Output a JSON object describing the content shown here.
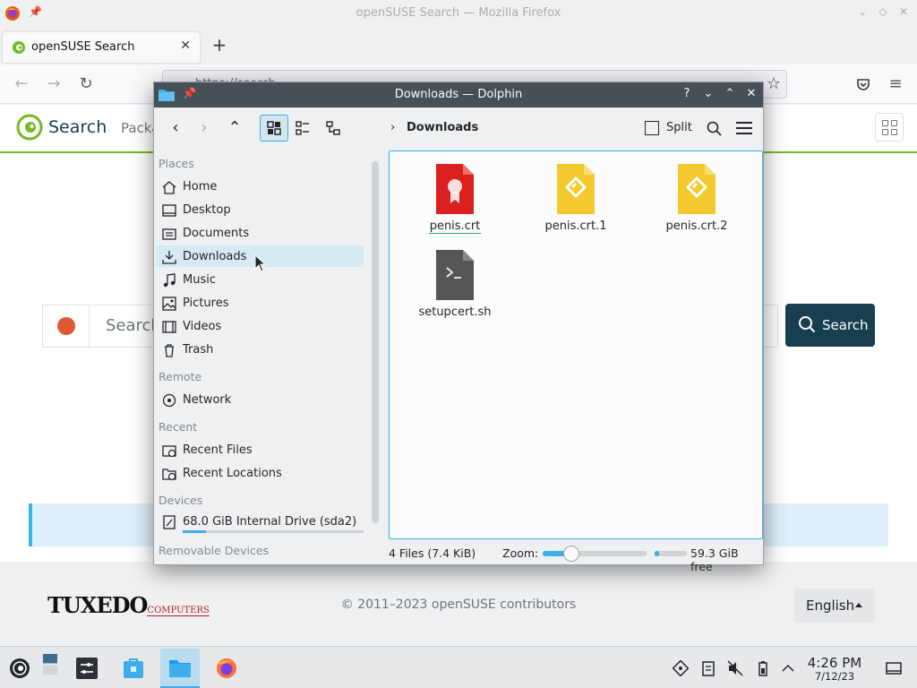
{
  "firefox": {
    "window_title": "openSUSE Search — Mozilla Firefox",
    "tab_label": "openSUSE Search",
    "tab_close": "✕",
    "new_tab": "+",
    "url_text": "https://search..."
  },
  "site": {
    "title": "Search",
    "nav_partial": "Packa",
    "search_placeholder": "Search",
    "search_button": "Search",
    "footer_brand_big": "TUXEDO",
    "footer_brand_small": "COMPUTERS",
    "copyright": "© 2011–2023 openSUSE contributors",
    "language": "English"
  },
  "dolphin": {
    "title": "Downloads — Dolphin",
    "breadcrumb_sep": "›",
    "breadcrumb": "Downloads",
    "split_label": "Split",
    "sidebar": {
      "places_header": "Places",
      "places": [
        {
          "label": "Home",
          "icon": "home-icon"
        },
        {
          "label": "Desktop",
          "icon": "desktop-icon"
        },
        {
          "label": "Documents",
          "icon": "documents-icon"
        },
        {
          "label": "Downloads",
          "icon": "downloads-icon"
        },
        {
          "label": "Music",
          "icon": "music-icon"
        },
        {
          "label": "Pictures",
          "icon": "pictures-icon"
        },
        {
          "label": "Videos",
          "icon": "videos-icon"
        },
        {
          "label": "Trash",
          "icon": "trash-icon"
        }
      ],
      "remote_header": "Remote",
      "remote": [
        {
          "label": "Network",
          "icon": "network-icon"
        }
      ],
      "recent_header": "Recent",
      "recent": [
        {
          "label": "Recent Files",
          "icon": "recent-files-icon"
        },
        {
          "label": "Recent Locations",
          "icon": "recent-locations-icon"
        }
      ],
      "devices_header": "Devices",
      "devices": [
        {
          "label": "68.0 GiB Internal Drive (sda2)",
          "icon": "drive-icon",
          "usage": 0.13
        }
      ],
      "removable_header": "Removable Devices"
    },
    "files": [
      {
        "name": "penis.crt",
        "icon": "certificate-file-icon",
        "color": "#da1f1f"
      },
      {
        "name": "penis.crt.1",
        "icon": "ebook-file-icon",
        "color": "#f4c92d"
      },
      {
        "name": "penis.crt.2",
        "icon": "ebook-file-icon",
        "color": "#f4c92d"
      },
      {
        "name": "setupcert.sh",
        "icon": "shell-script-file-icon",
        "color": "#555555"
      }
    ],
    "status": {
      "count": "4 Files (7.4 KiB)",
      "zoom_label": "Zoom:",
      "zoom_level": 0.28,
      "free": "59.3 GiB free",
      "disk_used": 0.13
    }
  },
  "taskbar": {
    "time": "4:26 PM",
    "date": "7/12/23"
  },
  "colors": {
    "opensuse_green": "#73ba25",
    "opensuse_dark": "#173f4f",
    "kde_blue": "#3daee9",
    "dolphin_titlebar": "#475057"
  }
}
